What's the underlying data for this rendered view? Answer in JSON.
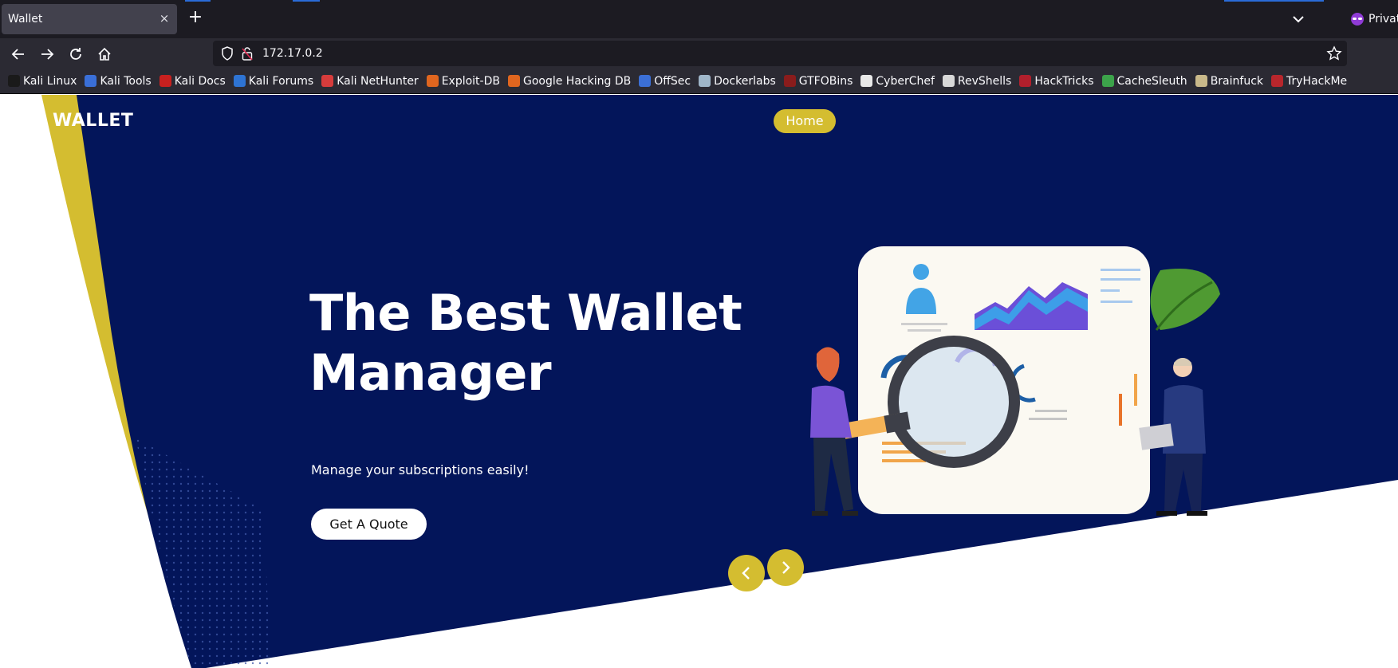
{
  "browser": {
    "tab_title": "Wallet",
    "tab_close": "×",
    "new_tab": "+",
    "url": "172.17.0.2",
    "private_label": "Privat"
  },
  "bookmarks": [
    {
      "label": "Kali Linux",
      "icon": "kali-dragon-icon",
      "color": "#1a1a1a"
    },
    {
      "label": "Kali Tools",
      "icon": "kali-tools-icon",
      "color": "#3a6fd8"
    },
    {
      "label": "Kali Docs",
      "icon": "kali-docs-icon",
      "color": "#c8201f"
    },
    {
      "label": "Kali Forums",
      "icon": "kali-forums-icon",
      "color": "#2e74d4"
    },
    {
      "label": "Kali NetHunter",
      "icon": "nethunter-icon",
      "color": "#d63c3c"
    },
    {
      "label": "Exploit-DB",
      "icon": "exploit-db-icon",
      "color": "#e0661f"
    },
    {
      "label": "Google Hacking DB",
      "icon": "ghdb-icon",
      "color": "#e0661f"
    },
    {
      "label": "OffSec",
      "icon": "offsec-icon",
      "color": "#3b6fd6"
    },
    {
      "label": "Dockerlabs",
      "icon": "dockerlabs-icon",
      "color": "#9fb6c9"
    },
    {
      "label": "GTFOBins",
      "icon": "gtfobins-icon",
      "color": "#8a1c1c"
    },
    {
      "label": "CyberChef",
      "icon": "cyberchef-icon",
      "color": "#e8e8e8"
    },
    {
      "label": "RevShells",
      "icon": "revshells-icon",
      "color": "#d8d8d8"
    },
    {
      "label": "HackTricks",
      "icon": "hacktricks-icon",
      "color": "#b11f2c"
    },
    {
      "label": "CacheSleuth",
      "icon": "cachesleuth-icon",
      "color": "#3ca34a"
    },
    {
      "label": "Brainfuck",
      "icon": "brainfuck-icon",
      "color": "#c9b98a"
    },
    {
      "label": "TryHackMe",
      "icon": "tryhackme-icon",
      "color": "#b8262c"
    }
  ],
  "site": {
    "brand": "WALLET",
    "nav_home": "Home",
    "hero_title_line1": "The Best Wallet",
    "hero_title_line2": "Manager",
    "hero_subtitle": "Manage your subscriptions easily!",
    "cta_label": "Get A Quote",
    "prev_icon": "‹",
    "next_icon": "›"
  },
  "colors": {
    "hero_navy": "#03155a",
    "accent_yellow": "#d4bd30",
    "chrome_dark": "#1c1b22",
    "chrome_bar": "#2b2a33"
  }
}
